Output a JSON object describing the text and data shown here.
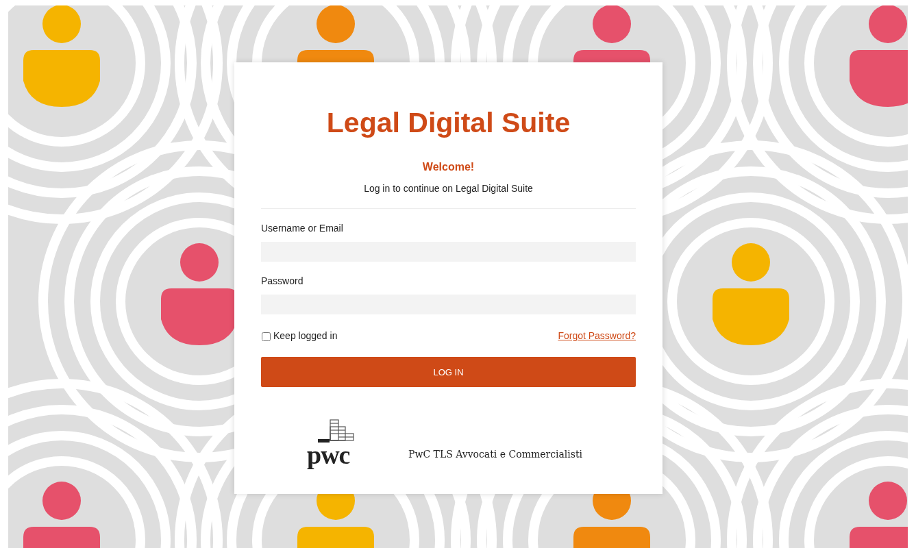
{
  "title": "Legal Digital Suite",
  "welcome": "Welcome!",
  "subtitle": "Log in to continue on Legal Digital Suite",
  "fields": [
    {
      "label": "Username or Email"
    },
    {
      "label": "Password"
    }
  ],
  "keep_logged_in": {
    "label": "Keep logged in",
    "checked": false
  },
  "forgot_password": "Forgot Password?",
  "login_button": "LOG IN",
  "footer": {
    "logo_text": "pwc",
    "firm_name": "PwC TLS Avvocati e Commercialisti"
  }
}
